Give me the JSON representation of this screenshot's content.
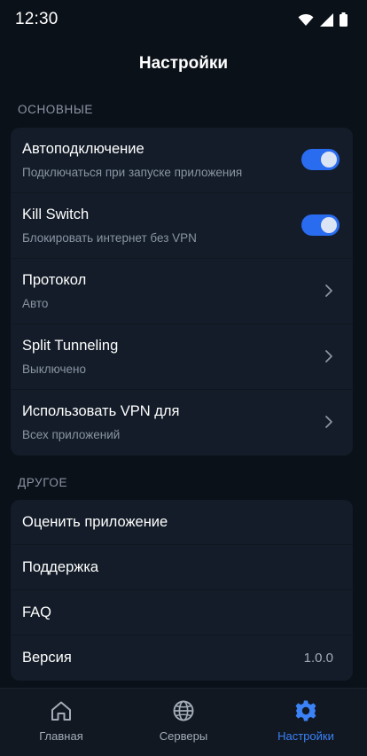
{
  "status_bar": {
    "time": "12:30"
  },
  "header": {
    "title": "Настройки"
  },
  "sections": {
    "main": {
      "label": "ОСНОВНЫЕ",
      "items": [
        {
          "title": "Автоподключение",
          "subtitle": "Подключаться при запуске приложения",
          "control": "toggle",
          "enabled": true
        },
        {
          "title": "Kill Switch",
          "subtitle": "Блокировать интернет без VPN",
          "control": "toggle",
          "enabled": true
        },
        {
          "title": "Протокол",
          "subtitle": "Авто",
          "control": "chevron"
        },
        {
          "title": "Split Tunneling",
          "subtitle": "Выключено",
          "control": "chevron"
        },
        {
          "title": "Использовать VPN для",
          "subtitle": "Всех приложений",
          "control": "chevron"
        }
      ]
    },
    "other": {
      "label": "ДРУГОЕ",
      "items": [
        {
          "title": "Оценить приложение"
        },
        {
          "title": "Поддержка"
        },
        {
          "title": "FAQ"
        },
        {
          "title": "Версия",
          "value": "1.0.0"
        }
      ]
    }
  },
  "bottom_nav": {
    "items": [
      {
        "label": "Главная",
        "icon": "home-icon",
        "active": false
      },
      {
        "label": "Серверы",
        "icon": "globe-icon",
        "active": false
      },
      {
        "label": "Настройки",
        "icon": "gear-icon",
        "active": true
      }
    ]
  },
  "colors": {
    "background": "#0b1119",
    "card": "#131c28",
    "accent": "#2a6cf0",
    "active_nav": "#3b82f6",
    "secondary_text": "#8a94a3"
  }
}
